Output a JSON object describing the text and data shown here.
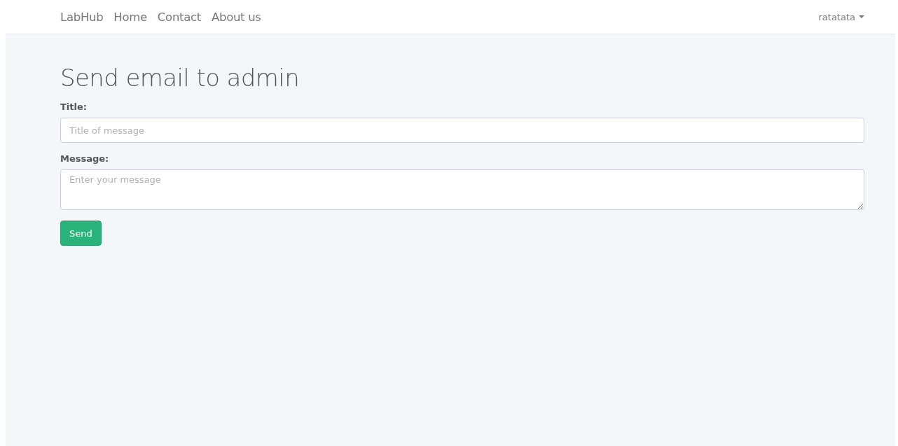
{
  "navbar": {
    "brand": "LabHub",
    "links": [
      "Home",
      "Contact",
      "About us"
    ],
    "user_menu": {
      "label": "ratatata"
    }
  },
  "page": {
    "heading": "Send email to admin",
    "fields": [
      {
        "kind": "input",
        "label": "Title:",
        "placeholder": "Title of message"
      },
      {
        "kind": "textarea",
        "label": "Message:",
        "placeholder": "Enter your message"
      }
    ],
    "submit_button": "Send"
  }
}
